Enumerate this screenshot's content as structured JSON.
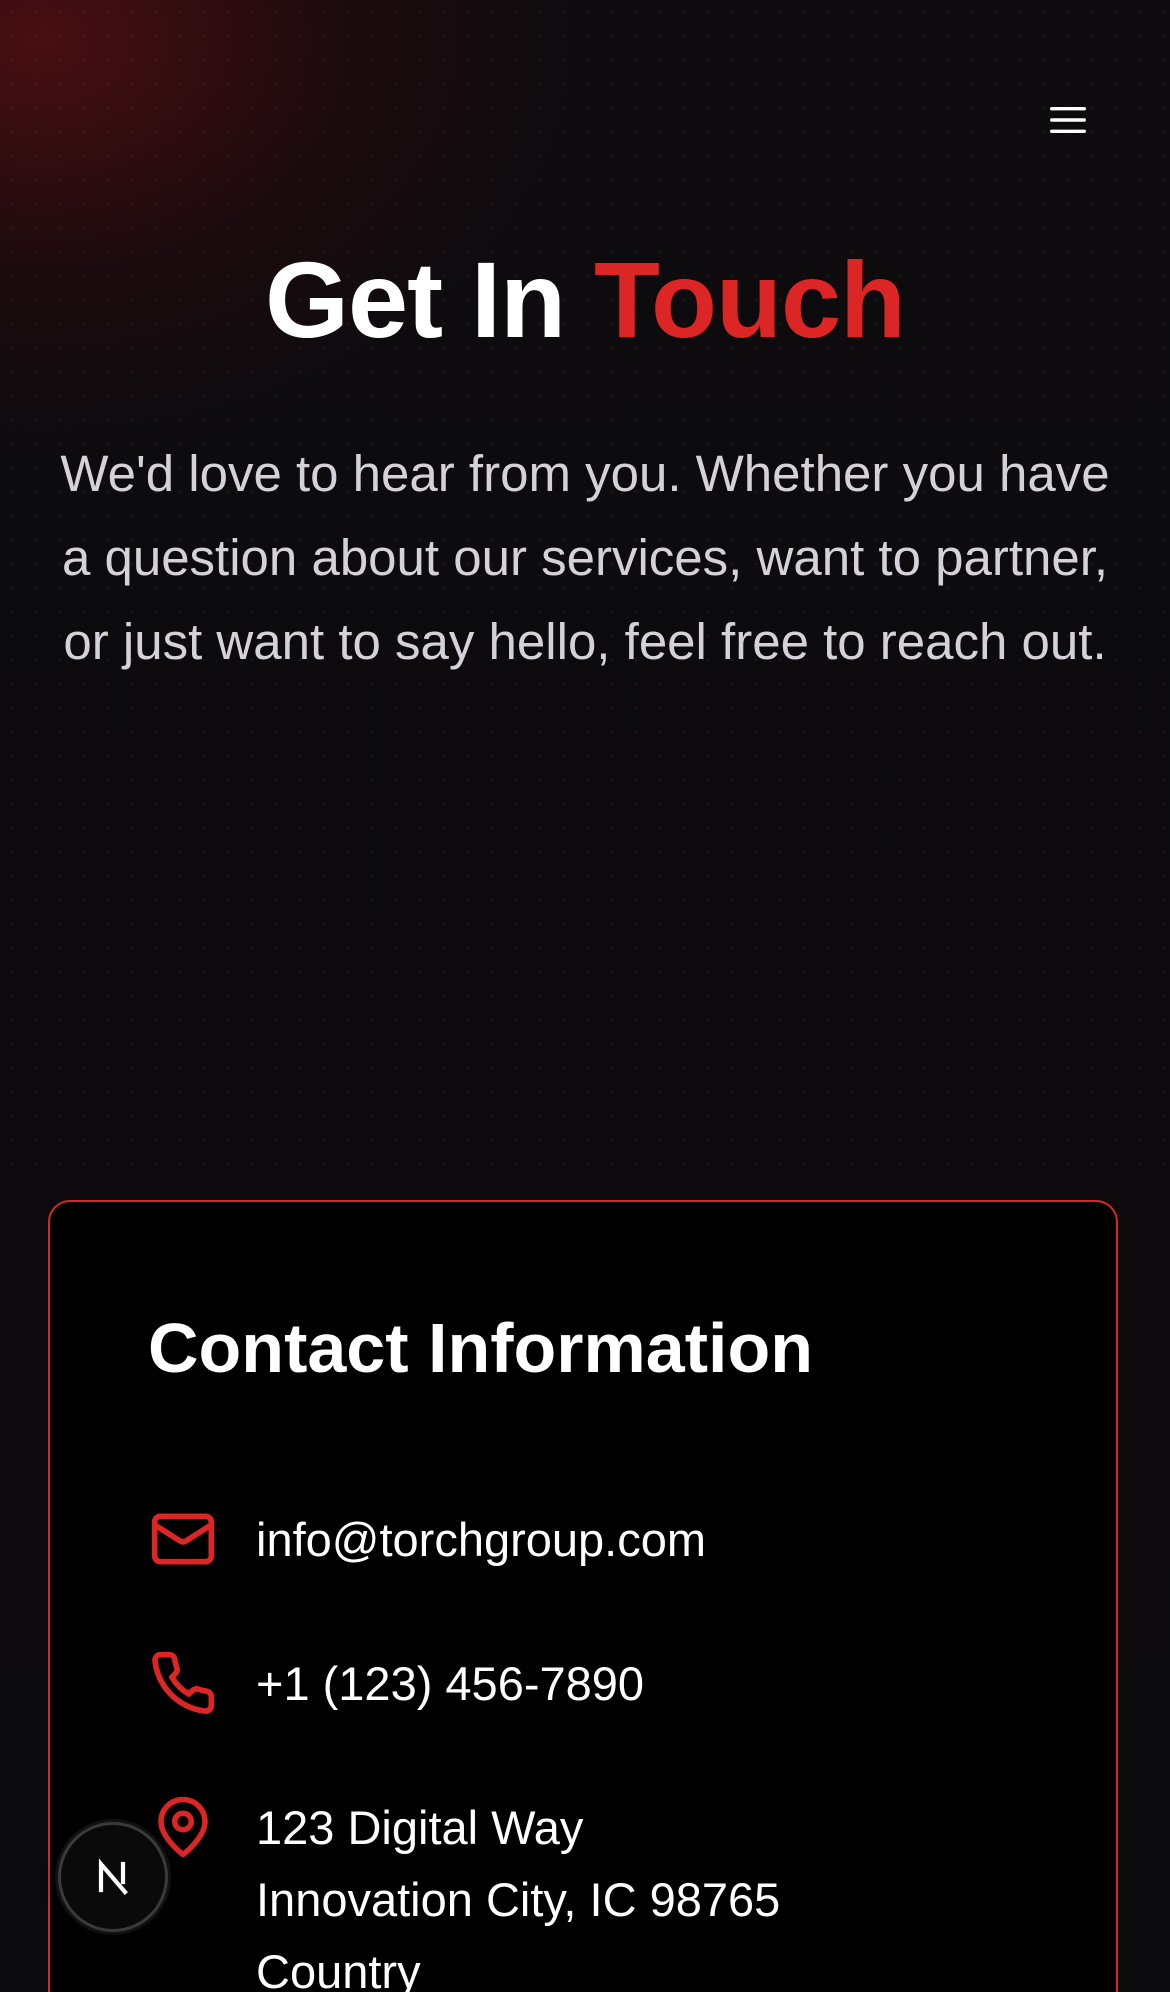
{
  "colors": {
    "accent": "#dc2626",
    "background": "#0b0a0c",
    "card_background": "#000000",
    "text_primary": "#ffffff",
    "text_muted": "#d4d2d8"
  },
  "header": {
    "menu_icon": "hamburger-menu-icon"
  },
  "hero": {
    "title_main": "Get In ",
    "title_accent": "Touch",
    "subtitle": "We'd love to hear from you. Whether you have a question about our services, want to partner, or just want to say hello, feel free to reach out."
  },
  "contact": {
    "title": "Contact Information",
    "email": {
      "icon": "mail-icon",
      "value": "info@torchgroup.com"
    },
    "phone": {
      "icon": "phone-icon",
      "value": "+1 (123) 456-7890"
    },
    "address": {
      "icon": "map-pin-icon",
      "lines": [
        "123 Digital Way",
        "Innovation City, IC 98765",
        "Country"
      ]
    }
  },
  "dev_badge": {
    "icon": "nextjs-logo-icon",
    "label": "N"
  }
}
